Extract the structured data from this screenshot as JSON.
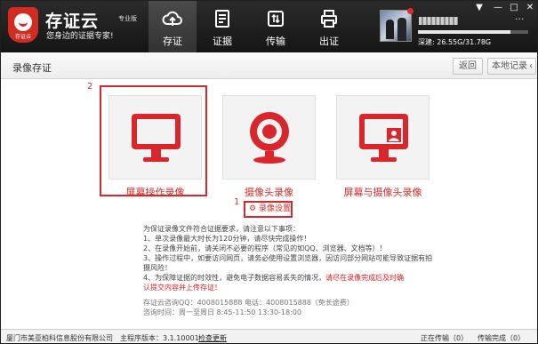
{
  "app": {
    "logo_caption": "存证云",
    "name": "存证云",
    "edition": "专业版",
    "slogan": "您身边的证据专家!"
  },
  "nav": [
    {
      "label": "存证",
      "icon": "cloud-upload-icon",
      "active": true
    },
    {
      "label": "证据",
      "icon": "document-icon",
      "active": false
    },
    {
      "label": "传输",
      "icon": "transfer-icon",
      "active": false
    },
    {
      "label": "出证",
      "icon": "printer-icon",
      "active": false
    }
  ],
  "user": {
    "storage_label": "深建: 26.55G/31.78G",
    "storage_used_fraction": 0.835
  },
  "window_controls": {
    "menu": "▼",
    "minimize": "—",
    "maximize": "□",
    "close": "✕",
    "more": "···"
  },
  "page": {
    "title": "录像存证",
    "back_button": "返回",
    "local_records_button": "本地记录",
    "local_records_arrow": "‹"
  },
  "annotations": {
    "first": "1",
    "second": "2"
  },
  "options": [
    {
      "label": "屏幕操作录像",
      "icon": "monitor-icon"
    },
    {
      "label": "摄像头录像",
      "icon": "webcam-icon"
    },
    {
      "label": "屏幕与摄像头录像",
      "icon": "monitor-person-icon"
    }
  ],
  "settings_link": {
    "icon": "gear-icon",
    "label": "录像设置"
  },
  "notes": {
    "intro": "为保证录像文件符合证据要求，请注意以下事项：",
    "item1": "1、单次录像最大时长为120分钟，请尽快完成操作！",
    "item2": "2、在录像开始前，请关闭不必要的程序（常见的如QQ、浏览器、文档等）！",
    "item3a": "3、操作过程中，如要访问网页，请务必使用设置浏览器，因访问部分网站可能导致证据有拍",
    "item3b": "摄风险！",
    "item4a": "4、为保障证据的时效性，避免电子数据容易丢失的情况，",
    "item4a_red": "请尽在录像完成后及时确",
    "item4b_red": "认提交内容并上传存证！",
    "contact1": "存证云咨询QQ：4008015888  电话：4008015888（免长途费）",
    "contact2": "咨询时间：周一至周日 8:45-11:50 13:30-18:00"
  },
  "statusbar": {
    "company": "厦门市美亚柏科信息股份有限公司",
    "version": "主程序版本：3.1.10001",
    "check_update": "检查更新",
    "uploading": "正在传输（0）",
    "completed": "传输完成（0）"
  },
  "colors": {
    "accent_red": "#d9262c",
    "titlebar": "#1c1c1c"
  }
}
